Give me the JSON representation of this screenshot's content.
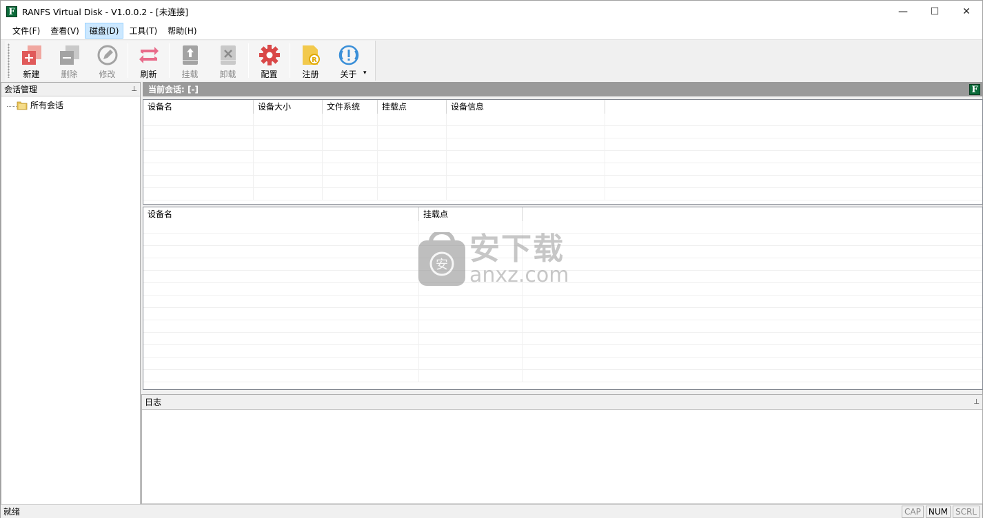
{
  "window": {
    "title": "RANFS Virtual Disk - V1.0.0.2 - [未连接]",
    "app_icon_letter": "F",
    "controls": {
      "minimize": "—",
      "maximize": "☐",
      "close": "✕"
    }
  },
  "menu": [
    {
      "label": "文件(F)",
      "active": false
    },
    {
      "label": "查看(V)",
      "active": false
    },
    {
      "label": "磁盘(D)",
      "active": true
    },
    {
      "label": "工具(T)",
      "active": false
    },
    {
      "label": "帮助(H)",
      "active": false
    }
  ],
  "toolbar": {
    "new_label": "新建",
    "delete_label": "删除",
    "edit_label": "修改",
    "refresh_label": "刷新",
    "mount_label": "挂载",
    "unmount_label": "卸载",
    "config_label": "配置",
    "register_label": "注册",
    "about_label": "关于",
    "more_glyph": "▾"
  },
  "left_panel": {
    "title": "会话管理",
    "pin_glyph": "⊥",
    "tree_root": "所有会话"
  },
  "session": {
    "label": "当前会话: [-]",
    "icon_letter": "F"
  },
  "devices_table": {
    "columns": [
      "设备名",
      "设备大小",
      "文件系统",
      "挂载点",
      "设备信息"
    ],
    "rows": []
  },
  "mounts_table": {
    "columns": [
      "设备名",
      "挂载点"
    ],
    "rows": []
  },
  "log_panel": {
    "title": "日志",
    "pin_glyph": "⊥"
  },
  "status": {
    "text": "就绪",
    "indicators": [
      {
        "label": "CAP",
        "on": false
      },
      {
        "label": "NUM",
        "on": true
      },
      {
        "label": "SCRL",
        "on": false
      }
    ]
  },
  "watermark": {
    "cn": "安下载",
    "en": "anxz.com",
    "shield_char": "安"
  },
  "colors": {
    "app_icon_green": "#0b6b3a",
    "menu_active_bg": "#cce8ff",
    "session_bar": "#9a9a9a",
    "icon_red": "#e05a5a",
    "icon_yellow": "#f2c94c",
    "icon_blue": "#3a8fd8"
  }
}
